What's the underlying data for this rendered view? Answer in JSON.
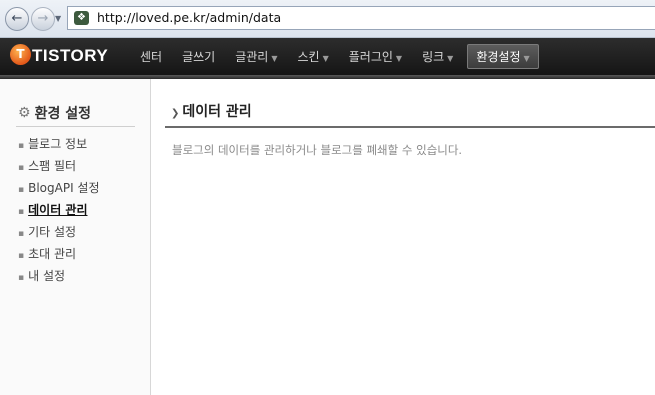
{
  "browser": {
    "url": "http://loved.pe.kr/admin/data"
  },
  "app": {
    "logo_text": "TISTORY",
    "logo_icon_glyph": "T"
  },
  "menu": {
    "items": [
      {
        "label": "센터",
        "has_caret": false
      },
      {
        "label": "글쓰기",
        "has_caret": false
      },
      {
        "label": "글관리",
        "has_caret": true
      },
      {
        "label": "스킨",
        "has_caret": true
      },
      {
        "label": "플러그인",
        "has_caret": true
      },
      {
        "label": "링크",
        "has_caret": true
      },
      {
        "label": "환경설정",
        "has_caret": true,
        "active": true
      }
    ]
  },
  "sidebar": {
    "title": "환경 설정",
    "items": [
      {
        "label": "블로그 정보"
      },
      {
        "label": "스팸 필터"
      },
      {
        "label": "BlogAPI 설정"
      },
      {
        "label": "데이터 관리",
        "active": true
      },
      {
        "label": "기타 설정"
      },
      {
        "label": "초대 관리"
      },
      {
        "label": "내 설정"
      }
    ]
  },
  "main": {
    "title": "데이터 관리",
    "description": "블로그의 데이터를 관리하거나 블로그를 폐쇄할 수 있습니다."
  },
  "colors": {
    "header_bg": "#1f1f1f",
    "logo_orange": "#e2581a"
  },
  "icons": [
    "back-arrow-icon",
    "forward-arrow-icon",
    "favicon-icon",
    "tistory-logo-icon",
    "gear-icon",
    "chevron-right-icon",
    "bullet-icon"
  ]
}
